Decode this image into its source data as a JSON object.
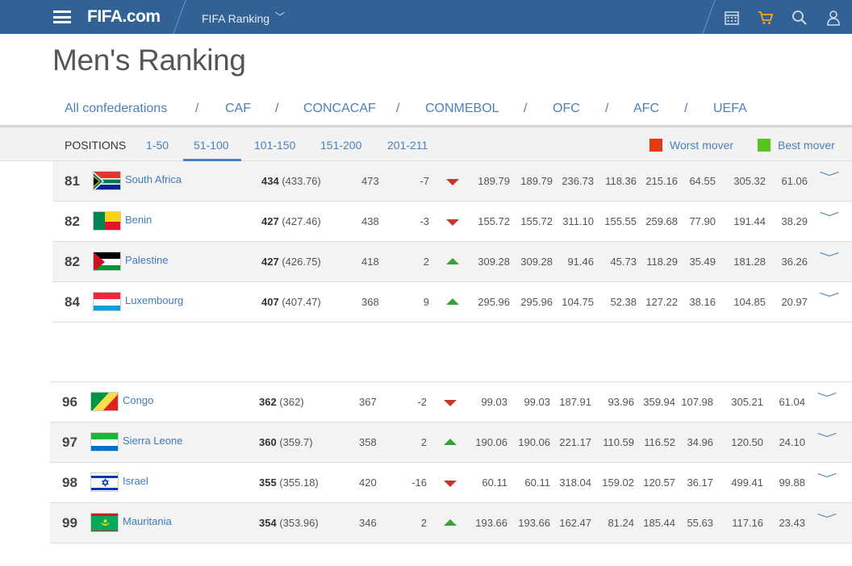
{
  "header": {
    "logo_text": "FIFA",
    "logo_suffix": ".com",
    "section": "FIFA Ranking",
    "icons": [
      "calendar-icon",
      "cart-icon",
      "search-icon",
      "user-icon"
    ],
    "brand_color": "#326295"
  },
  "page": {
    "title": "Men's Ranking"
  },
  "confederations": [
    "All confederations",
    "CAF",
    "CONCACAF",
    "CONMEBOL",
    "OFC",
    "AFC",
    "UEFA"
  ],
  "positions": {
    "label": "POSITIONS",
    "tabs": [
      "1-50",
      "51-100",
      "101-150",
      "151-200",
      "201-211"
    ],
    "active": "51-100"
  },
  "legend": {
    "worst_label": "Worst mover",
    "worst_color": "#e23b14",
    "best_label": "Best mover",
    "best_color": "#57c31e"
  },
  "rows_a": [
    {
      "rank": "81",
      "team": "South Africa",
      "pts": "434",
      "pts_exact": "(433.76)",
      "prev": "473",
      "move": "-7",
      "dir": "down",
      "c1": "189.79",
      "c2": "189.79",
      "c3": "236.73",
      "c4": "118.36",
      "c5": "215.16",
      "c6": "64.55",
      "c7": "305.32",
      "c8": "61.06",
      "flag": "za"
    },
    {
      "rank": "82",
      "team": "Benin",
      "pts": "427",
      "pts_exact": "(427.46)",
      "prev": "438",
      "move": "-3",
      "dir": "down",
      "c1": "155.72",
      "c2": "155.72",
      "c3": "311.10",
      "c4": "155.55",
      "c5": "259.68",
      "c6": "77.90",
      "c7": "191.44",
      "c8": "38.29",
      "flag": "bj"
    },
    {
      "rank": "82",
      "team": "Palestine",
      "pts": "427",
      "pts_exact": "(426.75)",
      "prev": "418",
      "move": "2",
      "dir": "up",
      "c1": "309.28",
      "c2": "309.28",
      "c3": "91.46",
      "c4": "45.73",
      "c5": "118.29",
      "c6": "35.49",
      "c7": "181.28",
      "c8": "36.26",
      "flag": "ps"
    },
    {
      "rank": "84",
      "team": "Luxembourg",
      "pts": "407",
      "pts_exact": "(407.47)",
      "prev": "368",
      "move": "9",
      "dir": "up",
      "c1": "295.96",
      "c2": "295.96",
      "c3": "104.75",
      "c4": "52.38",
      "c5": "127.22",
      "c6": "38.16",
      "c7": "104.85",
      "c8": "20.97",
      "flag": "lu"
    }
  ],
  "rows_b": [
    {
      "rank": "96",
      "team": "Congo",
      "pts": "362",
      "pts_exact": "(362)",
      "prev": "367",
      "move": "-2",
      "dir": "down",
      "c1": "99.03",
      "c2": "99.03",
      "c3": "187.91",
      "c4": "93.96",
      "c5": "359.94",
      "c6": "107.98",
      "c7": "305.21",
      "c8": "61.04",
      "flag": "cg"
    },
    {
      "rank": "97",
      "team": "Sierra Leone",
      "pts": "360",
      "pts_exact": "(359.7)",
      "prev": "358",
      "move": "2",
      "dir": "up",
      "c1": "190.06",
      "c2": "190.06",
      "c3": "221.17",
      "c4": "110.59",
      "c5": "116.52",
      "c6": "34.96",
      "c7": "120.50",
      "c8": "24.10",
      "flag": "sl"
    },
    {
      "rank": "98",
      "team": "Israel",
      "pts": "355",
      "pts_exact": "(355.18)",
      "prev": "420",
      "move": "-16",
      "dir": "down",
      "c1": "60.11",
      "c2": "60.11",
      "c3": "318.04",
      "c4": "159.02",
      "c5": "120.57",
      "c6": "36.17",
      "c7": "499.41",
      "c8": "99.88",
      "flag": "il"
    },
    {
      "rank": "99",
      "team": "Mauritania",
      "pts": "354",
      "pts_exact": "(353.96)",
      "prev": "346",
      "move": "2",
      "dir": "up",
      "c1": "193.66",
      "c2": "193.66",
      "c3": "162.47",
      "c4": "81.24",
      "c5": "185.44",
      "c6": "55.63",
      "c7": "117.16",
      "c8": "23.43",
      "flag": "mr"
    }
  ]
}
